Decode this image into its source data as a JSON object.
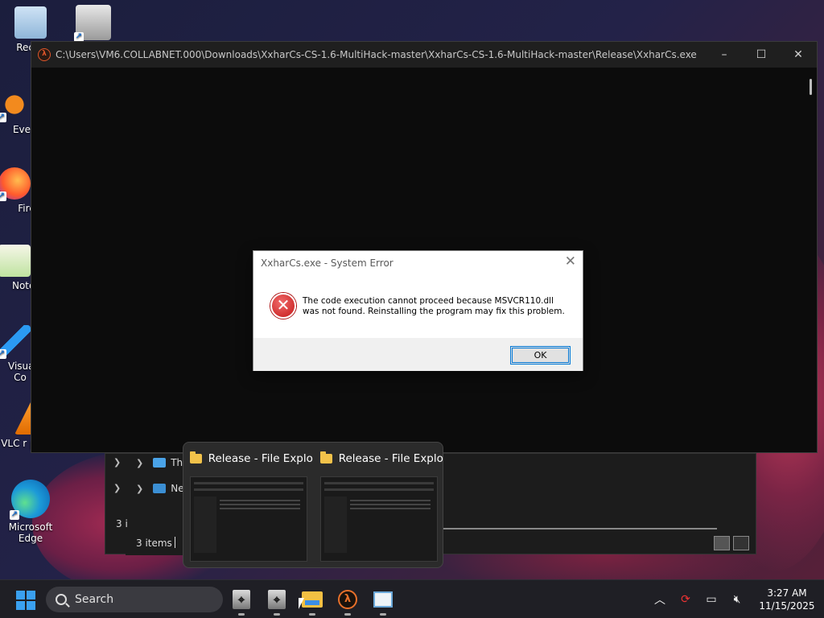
{
  "desktop": {
    "icons": [
      {
        "label": "Recyc",
        "icon": "recycle-bin-icon"
      },
      {
        "label": "",
        "icon": "counter-strike-icon"
      },
      {
        "label": "Every",
        "icon": "everything-search-icon"
      },
      {
        "label": "Fire",
        "icon": "firefox-icon"
      },
      {
        "label": "Notep",
        "icon": "notepad-plus-icon"
      },
      {
        "label": "Visual Co",
        "icon": "vscode-icon"
      },
      {
        "label": "VLC r player",
        "icon": "vlc-icon"
      },
      {
        "label": "Microsoft Edge",
        "icon": "edge-icon"
      }
    ]
  },
  "console": {
    "title": "C:\\Users\\VM6.COLLABNET.000\\Downloads\\XxharCs-CS-1.6-MultiHack-master\\XxharCs-CS-1.6-MultiHack-master\\Release\\XxharCs.exe",
    "minimize": "–",
    "maximize": "☐",
    "close": "✕"
  },
  "explorer": {
    "nav_items": [
      {
        "label": "Thi"
      },
      {
        "label": "Ne"
      }
    ],
    "status_back": "3 i",
    "status": "3 items"
  },
  "thumbnails": [
    {
      "title": "Release - File Explo..."
    },
    {
      "title": "Release - File Explo..."
    }
  ],
  "dialog": {
    "title": "XxharCs.exe - System Error",
    "message_line1": "The code execution cannot proceed because MSVCR110.dll",
    "message_line2": "was not found. Reinstalling the program may fix this problem.",
    "ok_label": "OK",
    "close_glyph": "✕"
  },
  "taskbar": {
    "search_label": "Search",
    "time": "3:27 AM",
    "date": "11/15/2025",
    "tray_icons": [
      "chevron-up-icon",
      "sync-icon",
      "display-icon",
      "volume-muted-icon"
    ]
  }
}
